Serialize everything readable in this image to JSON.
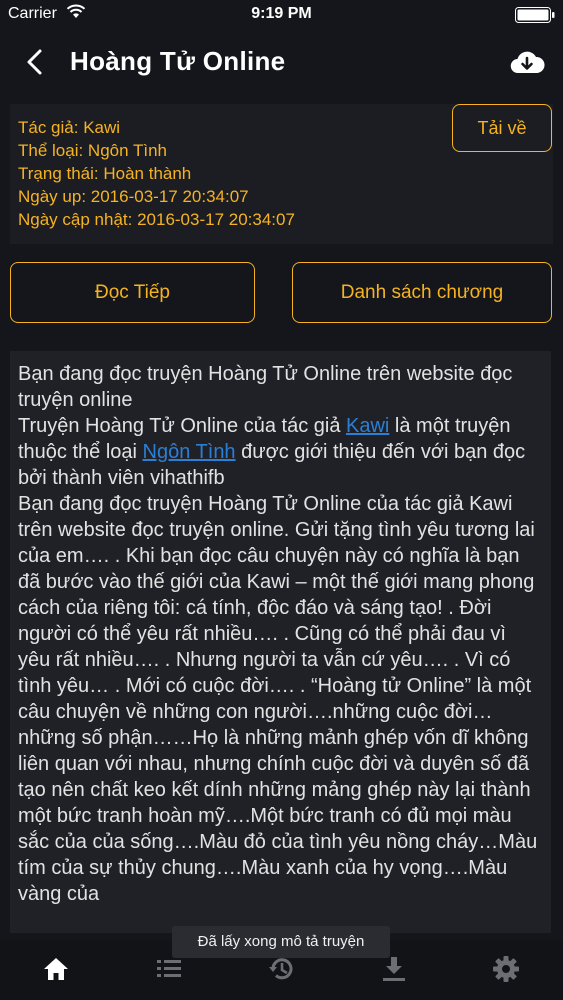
{
  "status_bar": {
    "carrier": "Carrier",
    "time": "9:19 PM"
  },
  "nav": {
    "title": "Hoàng Tử Online"
  },
  "info": {
    "author": "Tác giả: Kawi",
    "genre": "Thể loại: Ngôn Tình",
    "status": "Trạng thái: Hoàn thành",
    "date_up": "Ngày up: 2016-03-17 20:34:07",
    "date_updated": "Ngày cập nhật: 2016-03-17 20:34:07"
  },
  "buttons": {
    "download": "Tải về",
    "continue_reading": "Đọc Tiếp",
    "chapter_list": "Danh sách chương"
  },
  "description": {
    "intro": "Bạn đang đọc truyện Hoàng Tử Online trên website đọc truyện online",
    "line2_before": "Truyện Hoàng Tử Online của tác giả ",
    "author_link": "Kawi",
    "line2_middle": " là một truyện thuộc thể loại ",
    "genre_link": "Ngôn Tình",
    "line2_after": " được giới thiệu đến với bạn đọc bởi thành viên vihathifb",
    "body": "Bạn đang đọc truyện Hoàng Tử Online của tác giả Kawi trên website đọc truyện online. Gửi tặng tình yêu tương lai của em…. . Khi bạn đọc câu chuyện này có nghĩa là bạn đã bước vào thế giới của Kawi – một thế giới mang phong cách của riêng tôi: cá tính, độc đáo và sáng tạo! . Đời người có thể yêu rất nhiều…. . Cũng có thể phải đau vì yêu rất nhiều…. . Nhưng người ta vẫn cứ yêu…. . Vì có tình yêu… . Mới có cuộc đời…. . “Hoàng tử Online” là một câu chuyện về những con người….những cuộc đời… những số phận……Họ là những mảnh ghép vốn dĩ không liên quan với nhau, nhưng chính cuộc đời và duyên số đã tạo nên chất keo kết dính những mảng ghép này lại thành một bức tranh hoàn mỹ….Một bức tranh có đủ mọi màu sắc của của sống….Màu đỏ của tình yêu nồng cháy…Màu tím của sự thủy chung….Màu xanh của hy vọng….Màu vàng của"
  },
  "toast": "Đã lấy xong mô tả truyện",
  "tabs": [
    {
      "icon": "home-icon",
      "active": true
    },
    {
      "icon": "list-icon",
      "active": false
    },
    {
      "icon": "history-icon",
      "active": false
    },
    {
      "icon": "download-icon",
      "active": false
    },
    {
      "icon": "settings-icon",
      "active": false
    }
  ],
  "colors": {
    "accent": "#f5b321",
    "link": "#2a7fd6",
    "background": "#15161b",
    "active_tab": "#ffffff",
    "inactive_tab": "#6d6e73"
  }
}
